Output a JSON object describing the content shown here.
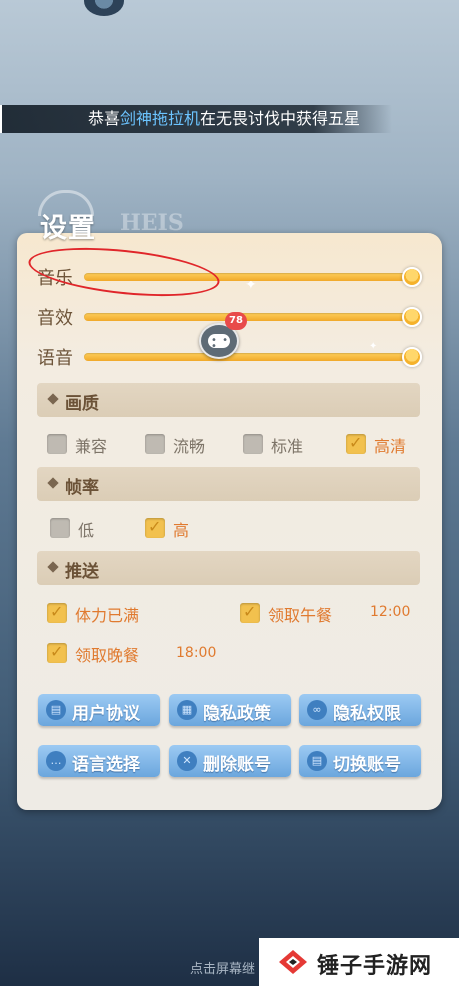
{
  "ticker": {
    "prefix": "恭喜",
    "player": "剑神拖拉机",
    "suffix": "在无畏讨伐中获得五星"
  },
  "panel": {
    "title": "设置",
    "title_ghost": "HEIS"
  },
  "sliders": [
    {
      "label": "音乐",
      "value": 1.0
    },
    {
      "label": "音效",
      "value": 1.0
    },
    {
      "label": "语音",
      "value": 1.0
    }
  ],
  "chat": {
    "badge": "78"
  },
  "sections": {
    "quality": {
      "label": "画质",
      "options": [
        {
          "label": "兼容",
          "checked": false
        },
        {
          "label": "流畅",
          "checked": false
        },
        {
          "label": "标准",
          "checked": false
        },
        {
          "label": "高清",
          "checked": true
        }
      ]
    },
    "framerate": {
      "label": "帧率",
      "options": [
        {
          "label": "低",
          "checked": false
        },
        {
          "label": "高",
          "checked": true
        }
      ]
    },
    "push": {
      "label": "推送",
      "options": [
        {
          "label": "体力已满",
          "checked": true,
          "time": ""
        },
        {
          "label": "领取午餐",
          "checked": true,
          "time": "12:00"
        },
        {
          "label": "领取晚餐",
          "checked": true,
          "time": "18:00"
        }
      ]
    }
  },
  "buttons": [
    {
      "label": "用户协议",
      "icon": "document-icon"
    },
    {
      "label": "隐私政策",
      "icon": "grid-icon"
    },
    {
      "label": "隐私权限",
      "icon": "link-icon"
    },
    {
      "label": "语言选择",
      "icon": "speech-icon"
    },
    {
      "label": "删除账号",
      "icon": "close-icon"
    },
    {
      "label": "切换账号",
      "icon": "document-icon"
    }
  ],
  "footer_hint": "点击屏幕继",
  "watermark": {
    "text": "锤子手游网"
  },
  "colors": {
    "accent": "#f0a92a",
    "checked_text": "#e07a2f",
    "button": "#6ba6dd"
  }
}
